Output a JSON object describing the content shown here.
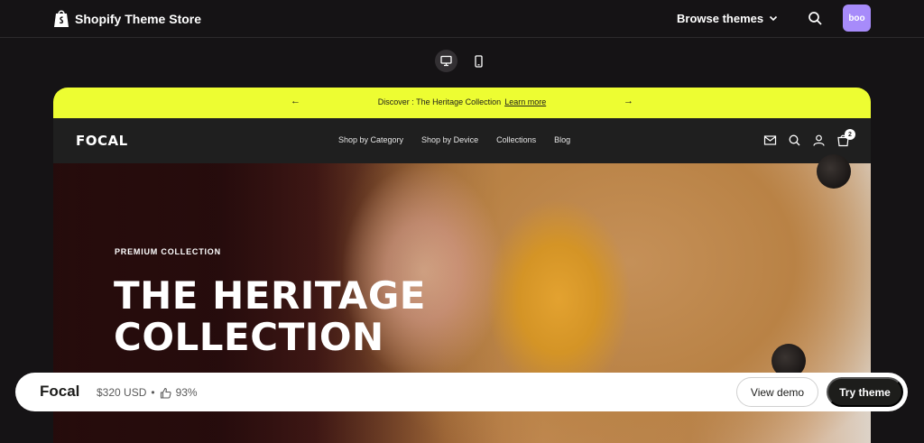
{
  "header": {
    "brand": "Shopify Theme Store",
    "browse_label": "Browse themes",
    "avatar_initials": "boo"
  },
  "device_toggle": {
    "icons": [
      "desktop-icon",
      "mobile-icon"
    ],
    "selected": "desktop"
  },
  "preview": {
    "announcement": {
      "text": "Discover : The Heritage Collection",
      "link": "Learn more",
      "prev": "←",
      "next": "→",
      "bg_color": "#edfd32"
    },
    "nav": {
      "logo": "FOCAL",
      "links": [
        "Shop by Category",
        "Shop by Device",
        "Collections",
        "Blog"
      ],
      "cart_count": "2",
      "icons": [
        "mail-icon",
        "search-icon",
        "account-icon",
        "cart-icon"
      ]
    },
    "hero": {
      "eyebrow": "PREMIUM COLLECTION",
      "title_line1": "THE HERITAGE",
      "title_line2": "COLLECTION"
    }
  },
  "bottom_bar": {
    "theme_name": "Focal",
    "price": "$320 USD",
    "separator": "•",
    "rating": "93%",
    "view_demo": "View demo",
    "try_theme": "Try theme"
  },
  "colors": {
    "page_bg": "#151315",
    "accent": "#edfd32",
    "avatar_bg": "#a78bfa"
  }
}
